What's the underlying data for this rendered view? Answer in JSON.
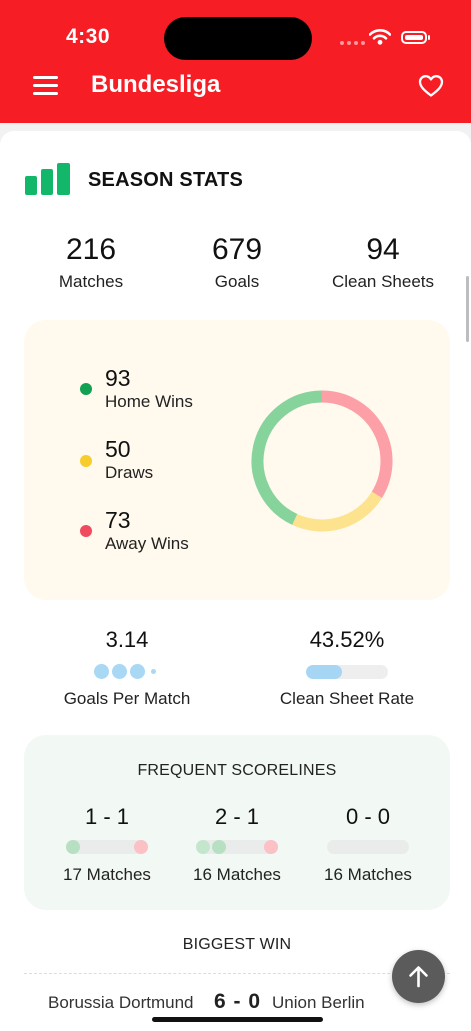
{
  "status_bar": {
    "time": "4:30"
  },
  "app_bar": {
    "title": "Bundesliga",
    "menu_icon": "menu-icon",
    "favorite_icon": "heart-outline-icon"
  },
  "season_stats": {
    "title": "SEASON STATS",
    "icon": "bar-chart-icon",
    "accent_color": "#12b76a",
    "summary": [
      {
        "value": "216",
        "label": "Matches"
      },
      {
        "value": "679",
        "label": "Goals"
      },
      {
        "value": "94",
        "label": "Clean Sheets"
      }
    ]
  },
  "results": {
    "items": [
      {
        "value": "93",
        "label": "Home Wins",
        "color": "#12a150"
      },
      {
        "value": "50",
        "label": "Draws",
        "color": "#f7cc2d"
      },
      {
        "value": "73",
        "label": "Away Wins",
        "color": "#f04a5e"
      }
    ],
    "chart_colors": {
      "home": "#86d39c",
      "draws": "#fde38d",
      "away": "#fc9fa6"
    }
  },
  "rates": {
    "goals_per_match": {
      "value": "3.14",
      "label": "Goals Per Match"
    },
    "clean_sheet_rate": {
      "value": "43.52%",
      "label": "Clean Sheet Rate",
      "fill_percent": 43.52
    }
  },
  "frequent_scorelines": {
    "title": "FREQUENT SCORELINES",
    "items": [
      {
        "score": "1 - 1",
        "label": "17 Matches"
      },
      {
        "score": "2 - 1",
        "label": "16 Matches"
      },
      {
        "score": "0 - 0",
        "label": "16 Matches"
      }
    ]
  },
  "biggest_win": {
    "title": "BIGGEST WIN",
    "home_team": "Borussia Dortmund",
    "score": "6 - 0",
    "away_team": "Union Berlin"
  },
  "scroll_top_icon": "arrow-up-icon"
}
